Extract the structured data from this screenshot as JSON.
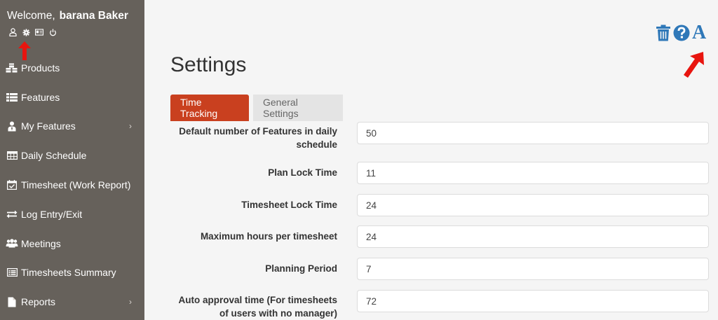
{
  "sidebar": {
    "welcome_prefix": "Welcome,",
    "user_name": "barana Baker",
    "items": [
      {
        "label": "Products",
        "icon": "cubes-icon",
        "has_arrow": false
      },
      {
        "label": "Features",
        "icon": "list-icon",
        "has_arrow": false
      },
      {
        "label": "My Features",
        "icon": "user-tie-icon",
        "has_arrow": true
      },
      {
        "label": "Daily Schedule",
        "icon": "table-icon",
        "has_arrow": false
      },
      {
        "label": "Timesheet (Work Report)",
        "icon": "calendar-check-icon",
        "has_arrow": false
      },
      {
        "label": "Log Entry/Exit",
        "icon": "exchange-icon",
        "has_arrow": false
      },
      {
        "label": "Meetings",
        "icon": "users-icon",
        "has_arrow": false
      },
      {
        "label": "Timesheets Summary",
        "icon": "list-alt-icon",
        "has_arrow": false
      },
      {
        "label": "Reports",
        "icon": "file-icon",
        "has_arrow": true
      }
    ]
  },
  "toolbar": {
    "font_glyph": "A"
  },
  "main": {
    "title": "Settings",
    "tabs": [
      {
        "label": "Time Tracking",
        "active": true
      },
      {
        "label": "General Settings",
        "active": false
      }
    ],
    "fields": [
      {
        "label_lines": [
          "Default number of Features in daily",
          "schedule"
        ],
        "value": "50"
      },
      {
        "label_lines": [
          "Plan Lock Time"
        ],
        "value": "11"
      },
      {
        "label_lines": [
          "Timesheet Lock Time"
        ],
        "value": "24"
      },
      {
        "label_lines": [
          "Maximum hours per timesheet"
        ],
        "value": "24"
      },
      {
        "label_lines": [
          "Planning Period"
        ],
        "value": "7"
      },
      {
        "label_lines": [
          "Auto approval time (For timesheets",
          "of users with no manager)"
        ],
        "value": "72"
      }
    ]
  },
  "colors": {
    "sidebar_bg": "#66615b",
    "accent_red": "#c9401f",
    "icon_blue": "#2f78b8",
    "annotation_red": "#e8150f"
  }
}
